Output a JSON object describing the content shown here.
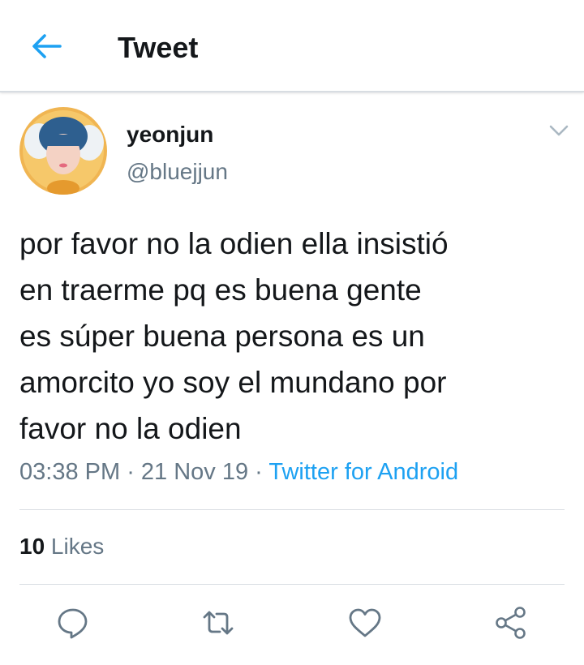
{
  "header": {
    "title": "Tweet"
  },
  "tweet": {
    "display_name": "yeonjun",
    "handle": "@bluejjun",
    "text": "por favor no la odien ella insistió\nen traerme pq es buena gente\nes súper buena persona es un\namorcito yo soy el mundano por\nfavor no la odien",
    "time": "03:38 PM",
    "separator": " · ",
    "date": "21 Nov 19",
    "source": "Twitter for Android",
    "likes_count": "10",
    "likes_label": " Likes"
  },
  "icons": [
    "back-arrow-icon",
    "chevron-down-icon",
    "reply-icon",
    "retweet-icon",
    "like-icon",
    "share-icon"
  ],
  "colors": {
    "accent": "#1da1f2",
    "text": "#14171a",
    "secondary": "#657786",
    "divider": "#d8dde2"
  }
}
